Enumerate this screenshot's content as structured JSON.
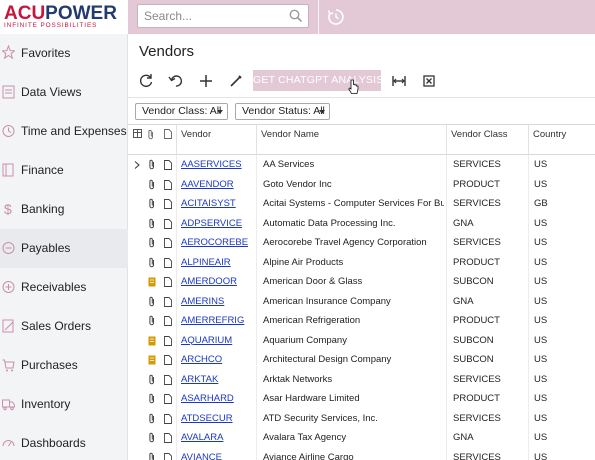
{
  "logo": {
    "part1": "ACU",
    "part2": "POWER",
    "tagline": "INFINITE POSSIBILITIES"
  },
  "search": {
    "placeholder": "Search..."
  },
  "sidebar": {
    "items": [
      {
        "label": "Favorites",
        "icon": "star-icon"
      },
      {
        "label": "Data Views",
        "icon": "data-views-icon"
      },
      {
        "label": "Time and Expenses",
        "icon": "clock-icon"
      },
      {
        "label": "Finance",
        "icon": "ledger-icon"
      },
      {
        "label": "Banking",
        "icon": "dollar-icon"
      },
      {
        "label": "Payables",
        "icon": "minus-circle-icon"
      },
      {
        "label": "Receivables",
        "icon": "plus-circle-icon"
      },
      {
        "label": "Sales Orders",
        "icon": "pencil-icon"
      },
      {
        "label": "Purchases",
        "icon": "cart-icon"
      },
      {
        "label": "Inventory",
        "icon": "truck-icon"
      },
      {
        "label": "Dashboards",
        "icon": "gauge-icon"
      }
    ],
    "active_index": 5
  },
  "page": {
    "title": "Vendors"
  },
  "toolbar": {
    "refresh_icon": "refresh-icon",
    "undo_icon": "undo-icon",
    "add_icon": "plus-icon",
    "edit_icon": "pencil-icon",
    "gpt_label": "GET CHATGPT ANALYSIS",
    "fit_icon": "fit-columns-icon",
    "excel_icon": "excel-export-icon"
  },
  "filters": {
    "vendor_class": "Vendor Class: All",
    "vendor_status": "Vendor Status: All"
  },
  "grid": {
    "headers": {
      "vendor": "Vendor",
      "vendor_name": "Vendor Name",
      "vendor_class": "Vendor Class",
      "country": "Country"
    },
    "rows": [
      {
        "vendor": "AASERVICES",
        "name": "AA Services",
        "class": "SERVICES",
        "country": "US",
        "attach": "paperclip"
      },
      {
        "vendor": "AAVENDOR",
        "name": "Goto Vendor Inc",
        "class": "PRODUCT",
        "country": "US",
        "attach": "paperclip"
      },
      {
        "vendor": "ACITAISYST",
        "name": "Acitai Systems - Computer Services For Bu...",
        "class": "SERVICES",
        "country": "GB",
        "attach": "paperclip"
      },
      {
        "vendor": "ADPSERVICE",
        "name": "Automatic Data Processing Inc.",
        "class": "GNA",
        "country": "US",
        "attach": "paperclip"
      },
      {
        "vendor": "AEROCOREBE",
        "name": "Aerocorebe Travel Agency Corporation",
        "class": "SERVICES",
        "country": "US",
        "attach": "paperclip"
      },
      {
        "vendor": "ALPINEAIR",
        "name": "Alpine Air Products",
        "class": "PRODUCT",
        "country": "US",
        "attach": "paperclip"
      },
      {
        "vendor": "AMERDOOR",
        "name": "American Door & Glass",
        "class": "SUBCON",
        "country": "US",
        "attach": "note"
      },
      {
        "vendor": "AMERINS",
        "name": "American Insurance Company",
        "class": "GNA",
        "country": "US",
        "attach": "paperclip"
      },
      {
        "vendor": "AMERREFRIG",
        "name": "American Refrigeration",
        "class": "PRODUCT",
        "country": "US",
        "attach": "paperclip"
      },
      {
        "vendor": "AQUARIUM",
        "name": "Aquarium Company",
        "class": "SUBCON",
        "country": "US",
        "attach": "note"
      },
      {
        "vendor": "ARCHCO",
        "name": "Architectural Design Company",
        "class": "SUBCON",
        "country": "US",
        "attach": "note"
      },
      {
        "vendor": "ARKTAK",
        "name": "Arktak Networks",
        "class": "SERVICES",
        "country": "US",
        "attach": "paperclip"
      },
      {
        "vendor": "ASARHARD",
        "name": "Asar Hardware Limited",
        "class": "PRODUCT",
        "country": "US",
        "attach": "paperclip"
      },
      {
        "vendor": "ATDSECUR",
        "name": "ATD Security Services, Inc.",
        "class": "SERVICES",
        "country": "US",
        "attach": "paperclip"
      },
      {
        "vendor": "AVALARA",
        "name": "Avalara Tax Agency",
        "class": "GNA",
        "country": "US",
        "attach": "paperclip"
      },
      {
        "vendor": "AVIANCE",
        "name": "Aviance Airline Cargo",
        "class": "SERVICES",
        "country": "US",
        "attach": "paperclip"
      }
    ]
  },
  "colors": {
    "accent": "#e3c9d6",
    "link": "#1a37c7",
    "brand_red": "#c5173e",
    "brand_navy": "#233a6e",
    "note_icon": "#d49a00"
  }
}
